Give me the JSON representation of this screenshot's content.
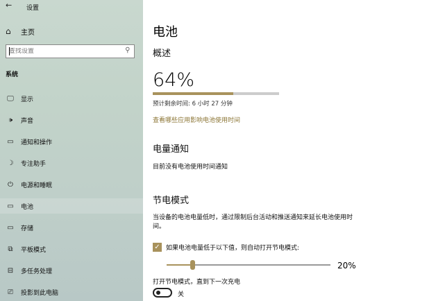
{
  "window": {
    "title": "设置",
    "back_glyph": "←"
  },
  "sidebar": {
    "home_label": "主页",
    "search_placeholder": "查找设置",
    "section_label": "系统",
    "items": [
      {
        "label": "显示",
        "icon": "monitor-icon"
      },
      {
        "label": "声音",
        "icon": "speaker-icon"
      },
      {
        "label": "通知和操作",
        "icon": "notification-icon"
      },
      {
        "label": "专注助手",
        "icon": "moon-icon"
      },
      {
        "label": "电源和睡眠",
        "icon": "power-icon"
      },
      {
        "label": "电池",
        "icon": "battery-icon",
        "active": true
      },
      {
        "label": "存储",
        "icon": "storage-icon"
      },
      {
        "label": "平板模式",
        "icon": "tablet-icon"
      },
      {
        "label": "多任务处理",
        "icon": "multitask-icon"
      },
      {
        "label": "投影到此电脑",
        "icon": "project-icon"
      }
    ]
  },
  "main": {
    "title": "电池",
    "overview": {
      "heading": "概述",
      "percent_text": "64%",
      "percent_value": 0.64,
      "remaining": "预计剩余时间: 6 小时 27 分钟",
      "link": "查看哪些应用影响电池使用时间"
    },
    "notification": {
      "heading": "电量通知",
      "text": "目前没有电池使用时间通知"
    },
    "saver": {
      "heading": "节电模式",
      "description_line1": "当设备的电池电量低时，通过限制后台活动和推送通知来延长电池使用时",
      "description_line2": "间。",
      "checkbox_label": "如果电池电量低于以下值，则自动打开节电模式:",
      "checkbox_checked": true,
      "slider_value": 20,
      "slider_text": "20%",
      "toggle_label": "打开节电模式，直到下一次充电",
      "toggle_state": "关"
    }
  },
  "colors": {
    "accent": "#a8925c",
    "link": "#8c7636"
  }
}
